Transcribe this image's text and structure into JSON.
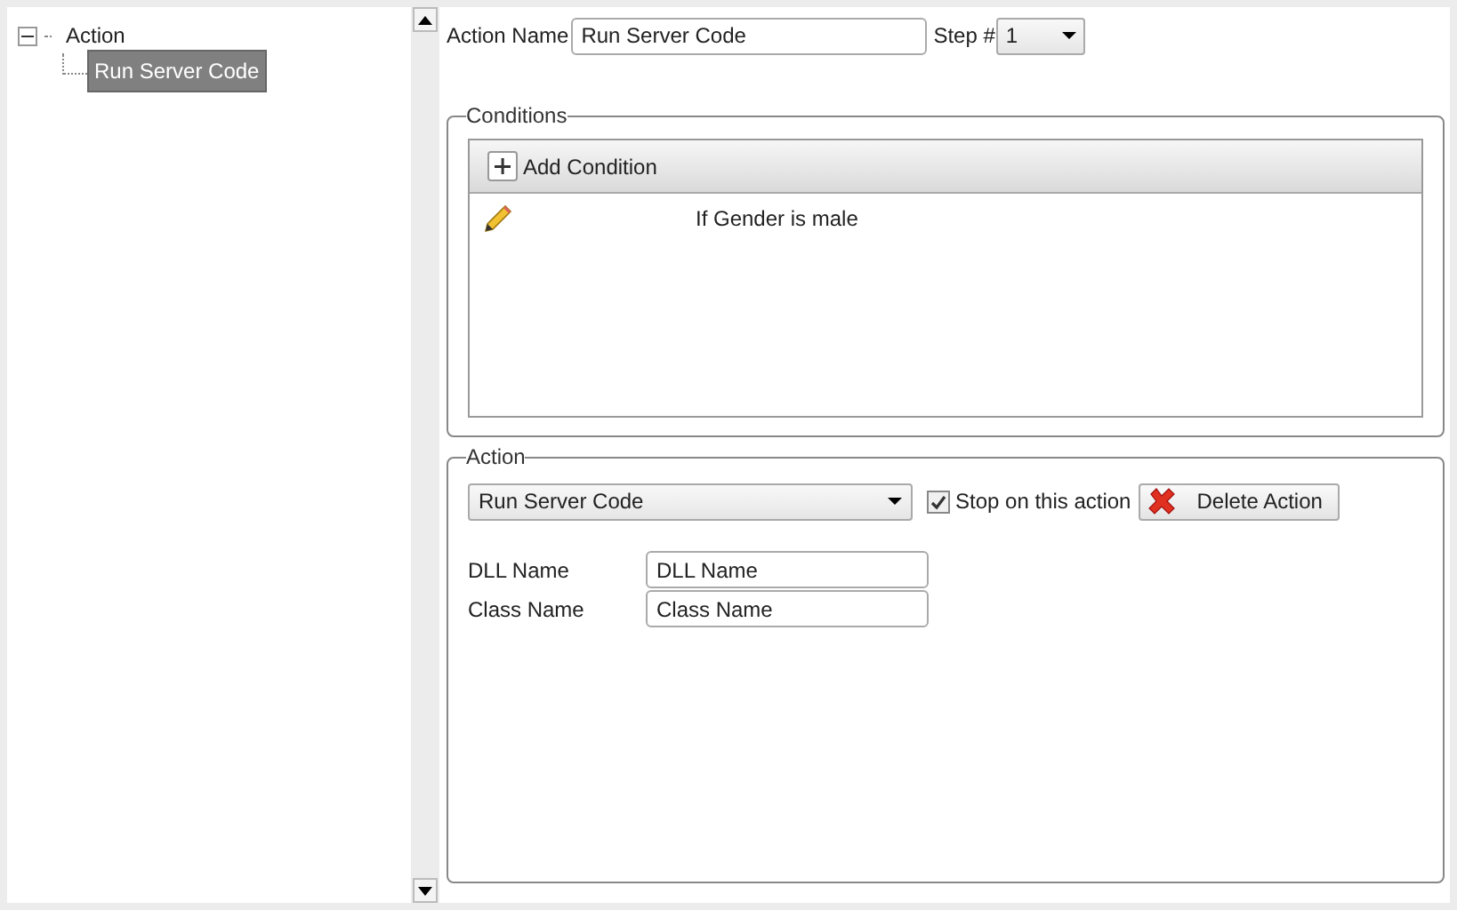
{
  "tree": [
    {
      "label": "Action",
      "expanded": true,
      "selected": false,
      "children": [
        {
          "label": "Run Server Code",
          "selected": true
        }
      ]
    }
  ],
  "header": {
    "action_name_label": "Action Name",
    "action_name_value": "Run Server Code",
    "step_label": "Step #",
    "step_value": "1"
  },
  "conditions": {
    "legend": "Conditions",
    "add_button": "Add Condition",
    "items": [
      {
        "text": "If Gender is male"
      }
    ]
  },
  "action": {
    "legend": "Action",
    "type_value": "Run Server Code",
    "stop_checkbox": {
      "label": "Stop on this action",
      "checked": true
    },
    "delete_button": "Delete Action",
    "fields": [
      {
        "label": "DLL Name",
        "value": "DLL Name"
      },
      {
        "label": "Class Name",
        "value": "Class Name"
      }
    ]
  }
}
